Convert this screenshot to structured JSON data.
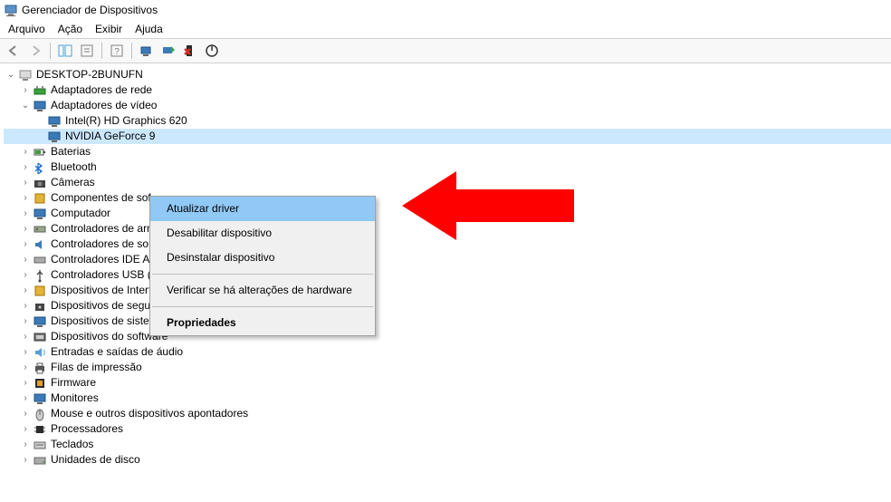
{
  "window": {
    "title": "Gerenciador de Dispositivos"
  },
  "menu": {
    "file": "Arquivo",
    "action": "Ação",
    "view": "Exibir",
    "help": "Ajuda"
  },
  "tree": {
    "root": "DESKTOP-2BUNUFN",
    "c_net": "Adaptadores de rede",
    "c_vid": "Adaptadores de vídeo",
    "vid1": "Intel(R) HD Graphics 620",
    "vid2": "NVIDIA GeForce 9",
    "c_bat": "Baterias",
    "c_bt": "Bluetooth",
    "c_cam": "Câmeras",
    "c_swc": "Componentes de sof",
    "c_pc": "Computador",
    "c_stor": "Controladores de arm",
    "c_svg": "Controladores de som, vídeo e jogos",
    "c_ide": "Controladores IDE ATA/ATAPI",
    "c_usb": "Controladores USB (barramento serial universal)",
    "c_hid": "Dispositivos de Interface Humana",
    "c_sec": "Dispositivos de segurança",
    "c_sys": "Dispositivos de sistema",
    "c_swd": "Dispositivos do software",
    "c_aud": "Entradas e saídas de áudio",
    "c_prq": "Filas de impressão",
    "c_fw": "Firmware",
    "c_mon": "Monitores",
    "c_mouse": "Mouse e outros dispositivos apontadores",
    "c_cpu": "Processadores",
    "c_kbd": "Teclados",
    "c_disk": "Unidades de disco"
  },
  "ctx": {
    "update": "Atualizar driver",
    "disable": "Desabilitar dispositivo",
    "uninstall": "Desinstalar dispositivo",
    "scan": "Verificar se há alterações de hardware",
    "props": "Propriedades"
  }
}
